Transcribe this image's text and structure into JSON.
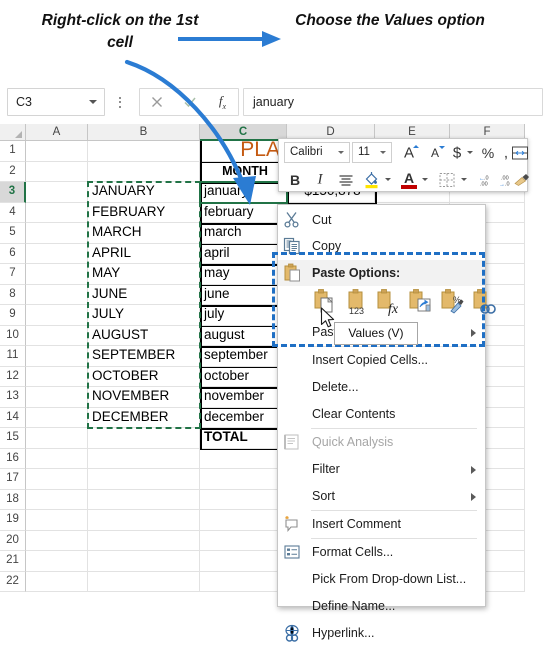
{
  "annotations": {
    "left_text": "Right-click on the 1st cell",
    "right_text": "Choose the Values option",
    "arrow_color": "#2b7cd3"
  },
  "formula_bar": {
    "name_box_value": "C3",
    "name_box_caret": "chevron-down-icon",
    "cancel_icon": "cancel-x-icon",
    "enter_icon": "check-icon",
    "function_icon": "fx-icon",
    "formula_value": "january"
  },
  "grid": {
    "columns": [
      "A",
      "B",
      "C",
      "D",
      "E",
      "F"
    ],
    "selected_column": "C",
    "selected_row": "3",
    "rows": [
      "1",
      "2",
      "3",
      "4",
      "5",
      "6",
      "7",
      "8",
      "9",
      "10",
      "11",
      "12",
      "13",
      "14",
      "15",
      "16",
      "17",
      "18",
      "19",
      "20",
      "21",
      "22"
    ],
    "cells": {
      "C1": "PLA",
      "C2": "MONTH",
      "D2": "",
      "D3": "$150,878",
      "C15": "TOTAL"
    },
    "col_b_values": [
      "JANUARY",
      "FEBRUARY",
      "MARCH",
      "APRIL",
      "MAY",
      "JUNE",
      "JULY",
      "AUGUST",
      "SEPTEMBER",
      "OCTOBER",
      "NOVEMBER",
      "DECEMBER"
    ],
    "col_c_values": [
      "january",
      "february",
      "march",
      "april",
      "may",
      "june",
      "july",
      "august",
      "september",
      "october",
      "november",
      "december"
    ],
    "marching_ants_color": "#217346",
    "active_cell_color": "#217346"
  },
  "mini_toolbar": {
    "font_name": "Calibri",
    "font_size": "11",
    "row1": [
      {
        "name": "grow-font-icon",
        "glyph": "A"
      },
      {
        "name": "shrink-font-icon",
        "glyph": "A"
      },
      {
        "name": "accounting-number-format-icon",
        "glyph": "$"
      },
      {
        "name": "percent-style-icon",
        "glyph": "%"
      },
      {
        "name": "comma-style-icon",
        "glyph": ","
      },
      {
        "name": "merge-cells-icon",
        "glyph": ""
      }
    ],
    "row2": [
      {
        "name": "bold-icon",
        "glyph": "B"
      },
      {
        "name": "italic-icon",
        "glyph": "I"
      },
      {
        "name": "align-icon",
        "glyph": ""
      },
      {
        "name": "fill-color-icon",
        "glyph": ""
      },
      {
        "name": "font-color-icon",
        "glyph": "A"
      },
      {
        "name": "borders-icon",
        "glyph": ""
      },
      {
        "name": "increase-decimal-icon",
        "glyph": ".00"
      },
      {
        "name": "decrease-decimal-icon",
        "glyph": ".00"
      },
      {
        "name": "format-painter-icon",
        "glyph": ""
      }
    ]
  },
  "context_menu": {
    "items": [
      {
        "label": "Cut",
        "icon": "scissors-icon",
        "disabled": false,
        "submenu": false
      },
      {
        "label": "Copy",
        "icon": "copy-icon",
        "disabled": false,
        "submenu": false
      },
      {
        "label": "Paste Options:",
        "icon": "paste-icon",
        "disabled": false,
        "submenu": false,
        "header": true
      },
      {
        "label": "Paste Special",
        "icon": "",
        "disabled": false,
        "submenu": true
      },
      {
        "label": "Insert Copied Cells...",
        "icon": "",
        "disabled": false,
        "submenu": false
      },
      {
        "label": "Delete...",
        "icon": "",
        "disabled": false,
        "submenu": false
      },
      {
        "label": "Clear Contents",
        "icon": "",
        "disabled": false,
        "submenu": false
      },
      {
        "label": "Quick Analysis",
        "icon": "quick-analysis-icon",
        "disabled": true,
        "submenu": false
      },
      {
        "label": "Filter",
        "icon": "",
        "disabled": false,
        "submenu": true
      },
      {
        "label": "Sort",
        "icon": "",
        "disabled": false,
        "submenu": true
      },
      {
        "label": "Insert Comment",
        "icon": "comment-icon",
        "disabled": false,
        "submenu": false
      },
      {
        "label": "Format Cells...",
        "icon": "format-cells-icon",
        "disabled": false,
        "submenu": false
      },
      {
        "label": "Pick From Drop-down List...",
        "icon": "",
        "disabled": false,
        "submenu": false
      },
      {
        "label": "Define Name...",
        "icon": "",
        "disabled": false,
        "submenu": false
      },
      {
        "label": "Hyperlink...",
        "icon": "hyperlink-icon",
        "disabled": false,
        "submenu": false
      }
    ],
    "paste_buttons": [
      {
        "name": "paste-all-icon",
        "badge": ""
      },
      {
        "name": "paste-values-icon",
        "badge": "123"
      },
      {
        "name": "paste-formulas-icon",
        "badge": "fx"
      },
      {
        "name": "paste-transpose-icon",
        "badge": ""
      },
      {
        "name": "paste-formatting-icon",
        "badge": "%"
      },
      {
        "name": "paste-link-icon",
        "badge": ""
      }
    ],
    "tooltip": "Values (V)",
    "highlight_color": "#1f6fc4"
  }
}
